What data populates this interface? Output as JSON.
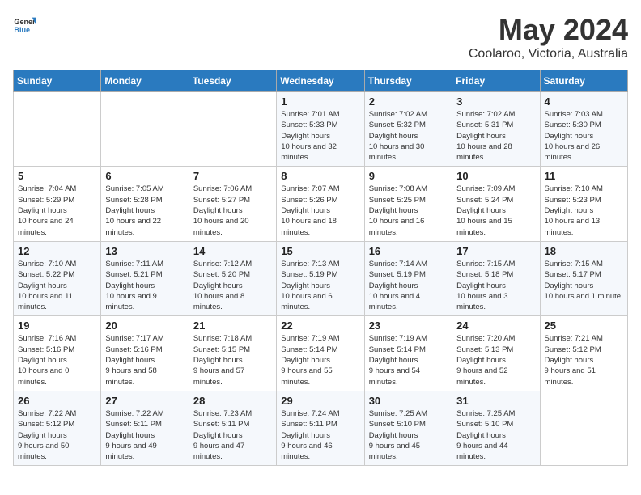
{
  "header": {
    "logo_general": "General",
    "logo_blue": "Blue",
    "month_year": "May 2024",
    "location": "Coolaroo, Victoria, Australia"
  },
  "days_of_week": [
    "Sunday",
    "Monday",
    "Tuesday",
    "Wednesday",
    "Thursday",
    "Friday",
    "Saturday"
  ],
  "weeks": [
    [
      {
        "day": "",
        "sunrise": "",
        "sunset": "",
        "daylight": ""
      },
      {
        "day": "",
        "sunrise": "",
        "sunset": "",
        "daylight": ""
      },
      {
        "day": "",
        "sunrise": "",
        "sunset": "",
        "daylight": ""
      },
      {
        "day": "1",
        "sunrise": "7:01 AM",
        "sunset": "5:33 PM",
        "daylight": "10 hours and 32 minutes."
      },
      {
        "day": "2",
        "sunrise": "7:02 AM",
        "sunset": "5:32 PM",
        "daylight": "10 hours and 30 minutes."
      },
      {
        "day": "3",
        "sunrise": "7:02 AM",
        "sunset": "5:31 PM",
        "daylight": "10 hours and 28 minutes."
      },
      {
        "day": "4",
        "sunrise": "7:03 AM",
        "sunset": "5:30 PM",
        "daylight": "10 hours and 26 minutes."
      }
    ],
    [
      {
        "day": "5",
        "sunrise": "7:04 AM",
        "sunset": "5:29 PM",
        "daylight": "10 hours and 24 minutes."
      },
      {
        "day": "6",
        "sunrise": "7:05 AM",
        "sunset": "5:28 PM",
        "daylight": "10 hours and 22 minutes."
      },
      {
        "day": "7",
        "sunrise": "7:06 AM",
        "sunset": "5:27 PM",
        "daylight": "10 hours and 20 minutes."
      },
      {
        "day": "8",
        "sunrise": "7:07 AM",
        "sunset": "5:26 PM",
        "daylight": "10 hours and 18 minutes."
      },
      {
        "day": "9",
        "sunrise": "7:08 AM",
        "sunset": "5:25 PM",
        "daylight": "10 hours and 16 minutes."
      },
      {
        "day": "10",
        "sunrise": "7:09 AM",
        "sunset": "5:24 PM",
        "daylight": "10 hours and 15 minutes."
      },
      {
        "day": "11",
        "sunrise": "7:10 AM",
        "sunset": "5:23 PM",
        "daylight": "10 hours and 13 minutes."
      }
    ],
    [
      {
        "day": "12",
        "sunrise": "7:10 AM",
        "sunset": "5:22 PM",
        "daylight": "10 hours and 11 minutes."
      },
      {
        "day": "13",
        "sunrise": "7:11 AM",
        "sunset": "5:21 PM",
        "daylight": "10 hours and 9 minutes."
      },
      {
        "day": "14",
        "sunrise": "7:12 AM",
        "sunset": "5:20 PM",
        "daylight": "10 hours and 8 minutes."
      },
      {
        "day": "15",
        "sunrise": "7:13 AM",
        "sunset": "5:19 PM",
        "daylight": "10 hours and 6 minutes."
      },
      {
        "day": "16",
        "sunrise": "7:14 AM",
        "sunset": "5:19 PM",
        "daylight": "10 hours and 4 minutes."
      },
      {
        "day": "17",
        "sunrise": "7:15 AM",
        "sunset": "5:18 PM",
        "daylight": "10 hours and 3 minutes."
      },
      {
        "day": "18",
        "sunrise": "7:15 AM",
        "sunset": "5:17 PM",
        "daylight": "10 hours and 1 minute."
      }
    ],
    [
      {
        "day": "19",
        "sunrise": "7:16 AM",
        "sunset": "5:16 PM",
        "daylight": "10 hours and 0 minutes."
      },
      {
        "day": "20",
        "sunrise": "7:17 AM",
        "sunset": "5:16 PM",
        "daylight": "9 hours and 58 minutes."
      },
      {
        "day": "21",
        "sunrise": "7:18 AM",
        "sunset": "5:15 PM",
        "daylight": "9 hours and 57 minutes."
      },
      {
        "day": "22",
        "sunrise": "7:19 AM",
        "sunset": "5:14 PM",
        "daylight": "9 hours and 55 minutes."
      },
      {
        "day": "23",
        "sunrise": "7:19 AM",
        "sunset": "5:14 PM",
        "daylight": "9 hours and 54 minutes."
      },
      {
        "day": "24",
        "sunrise": "7:20 AM",
        "sunset": "5:13 PM",
        "daylight": "9 hours and 52 minutes."
      },
      {
        "day": "25",
        "sunrise": "7:21 AM",
        "sunset": "5:12 PM",
        "daylight": "9 hours and 51 minutes."
      }
    ],
    [
      {
        "day": "26",
        "sunrise": "7:22 AM",
        "sunset": "5:12 PM",
        "daylight": "9 hours and 50 minutes."
      },
      {
        "day": "27",
        "sunrise": "7:22 AM",
        "sunset": "5:11 PM",
        "daylight": "9 hours and 49 minutes."
      },
      {
        "day": "28",
        "sunrise": "7:23 AM",
        "sunset": "5:11 PM",
        "daylight": "9 hours and 47 minutes."
      },
      {
        "day": "29",
        "sunrise": "7:24 AM",
        "sunset": "5:11 PM",
        "daylight": "9 hours and 46 minutes."
      },
      {
        "day": "30",
        "sunrise": "7:25 AM",
        "sunset": "5:10 PM",
        "daylight": "9 hours and 45 minutes."
      },
      {
        "day": "31",
        "sunrise": "7:25 AM",
        "sunset": "5:10 PM",
        "daylight": "9 hours and 44 minutes."
      },
      {
        "day": "",
        "sunrise": "",
        "sunset": "",
        "daylight": ""
      }
    ]
  ],
  "labels": {
    "sunrise": "Sunrise:",
    "sunset": "Sunset:",
    "daylight": "Daylight hours"
  }
}
